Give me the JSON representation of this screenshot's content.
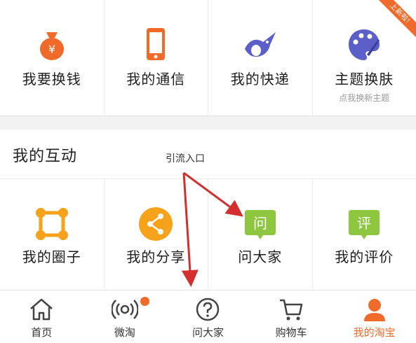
{
  "colors": {
    "accent": "#f06a2a",
    "blue_purple": "#5b5fc7",
    "green": "#8dc63f",
    "arrow_red": "#d32f2f"
  },
  "top_grid": [
    {
      "label": "我要换钱",
      "icon": "money-bag-icon"
    },
    {
      "label": "我的通信",
      "icon": "phone-icon"
    },
    {
      "label": "我的快递",
      "icon": "bird-icon"
    },
    {
      "label": "主题换肤",
      "icon": "palette-icon",
      "sub": "点我换新主题",
      "ribbon": "上新啦!"
    }
  ],
  "interaction": {
    "title": "我的互动",
    "items": [
      {
        "label": "我的圈子",
        "icon": "circle-group-icon"
      },
      {
        "label": "我的分享",
        "icon": "share-icon"
      },
      {
        "label": "问大家",
        "icon": "ask-bubble-icon",
        "badge_text": "问"
      },
      {
        "label": "我的评价",
        "icon": "review-bubble-icon",
        "badge_text": "评"
      }
    ]
  },
  "annotation": {
    "text": "引流入口"
  },
  "tabbar": {
    "items": [
      {
        "label": "首页",
        "icon": "home-icon"
      },
      {
        "label": "微淘",
        "icon": "broadcast-icon"
      },
      {
        "label": "问大家",
        "icon": "question-icon"
      },
      {
        "label": "购物车",
        "icon": "cart-icon"
      },
      {
        "label": "我的淘宝",
        "icon": "user-icon"
      }
    ]
  }
}
